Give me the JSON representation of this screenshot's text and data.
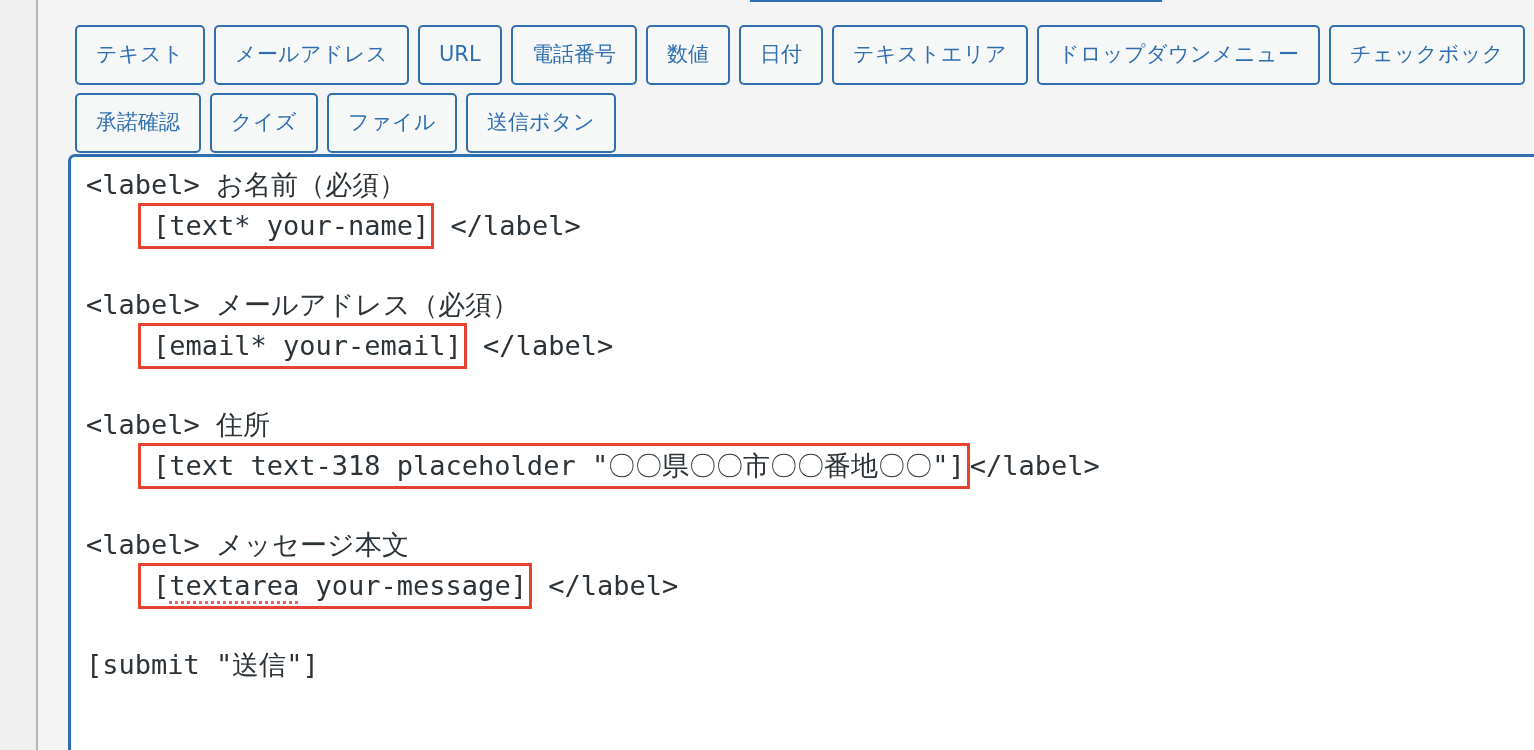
{
  "tag_buttons": [
    [
      "テキスト",
      "メールアドレス",
      "URL",
      "電話番号",
      "数値",
      "日付",
      "テキストエリア",
      "ドロップダウンメニュー",
      "チェックボック"
    ],
    [
      "承諾確認",
      "クイズ",
      "ファイル",
      "送信ボタン"
    ]
  ],
  "editor": {
    "fields": [
      {
        "label_line": "<label> お名前（必須）",
        "shortcode": [
          {
            "text": "[text* your-name]",
            "misspelled": false
          }
        ],
        "highlighted": true,
        "closing": " </label>"
      },
      {
        "label_line": "<label> メールアドレス（必須）",
        "shortcode": [
          {
            "text": "[email* your-email]",
            "misspelled": false
          }
        ],
        "highlighted": true,
        "closing": " </label>"
      },
      {
        "label_line": "<label> 住所",
        "shortcode": [
          {
            "text": "[text text-318 placeholder \"〇〇県〇〇市〇〇番地〇〇\"]",
            "misspelled": false
          }
        ],
        "highlighted": true,
        "closing": "</label>"
      },
      {
        "label_line": "<label> メッセージ本文",
        "shortcode": [
          {
            "text": "[",
            "misspelled": false
          },
          {
            "text": "textarea",
            "misspelled": true
          },
          {
            "text": " your-message]",
            "misspelled": false
          }
        ],
        "highlighted": true,
        "closing": " </label>"
      }
    ],
    "submit_line": "[submit \"送信\"]"
  }
}
